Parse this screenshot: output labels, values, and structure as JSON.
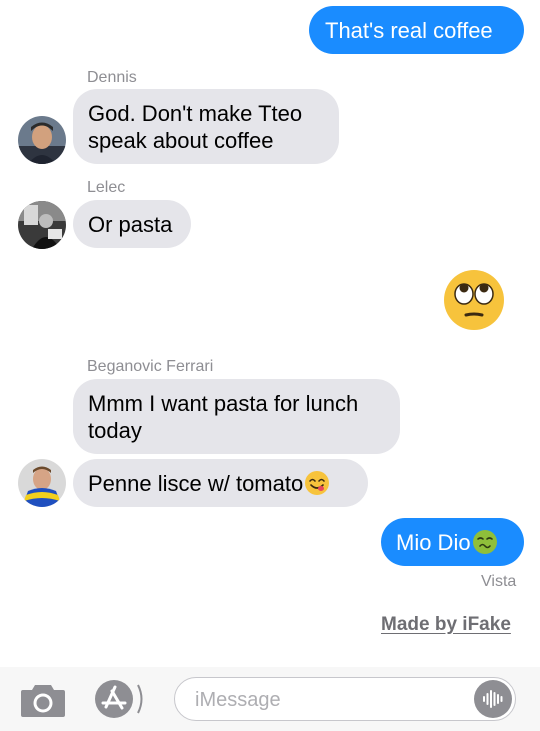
{
  "messages": [
    {
      "text": "That's real coffee"
    },
    {
      "sender": "Dennis",
      "text": "God. Don't make Tteo speak about coffee"
    },
    {
      "sender": "Lelec",
      "text": "Or pasta"
    },
    {
      "emoji": "face-with-rolling-eyes"
    },
    {
      "sender": "Beganovic Ferrari",
      "text": "Mmm I want pasta for lunch today"
    },
    {
      "text": "Penne lisce w/ tomato",
      "emoji": "face-savoring-food"
    },
    {
      "text": "Mio Dio",
      "emoji": "nauseated-face",
      "status": "Vista"
    }
  ],
  "credit": "Made by iFake",
  "composer": {
    "placeholder": "iMessage",
    "camera_icon": "camera-icon",
    "apps_icon": "app-store-icon",
    "audio_icon": "audio-waveform-icon"
  },
  "colors": {
    "outgoing_bubble": "#1a8cff",
    "incoming_bubble": "#e5e5ea",
    "secondary_text": "#8e8e93"
  }
}
